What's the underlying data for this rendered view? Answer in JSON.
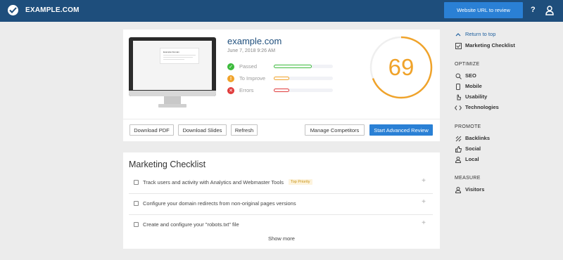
{
  "header": {
    "brand": "EXAMPLE.COM",
    "url_button": "Website URL to review",
    "help": "?"
  },
  "summary": {
    "thumbnail_title": "Example Domain",
    "site": "example.com",
    "date": "June 7, 2018 9:26 AM",
    "score": "69",
    "score_fraction": 0.69,
    "status": [
      {
        "label": "Passed",
        "color": "#3cba3c",
        "symbol": "✓",
        "level": 0.64
      },
      {
        "label": "To Improve",
        "color": "#f0a32a",
        "symbol": "!",
        "level": 0.26
      },
      {
        "label": "Errors",
        "color": "#e03b3b",
        "symbol": "✕",
        "level": 0.26
      }
    ],
    "buttons": {
      "download_pdf": "Download PDF",
      "download_slides": "Download Slides",
      "refresh": "Refresh",
      "manage_competitors": "Manage Competitors",
      "start_review": "Start Advanced Review"
    }
  },
  "checklist": {
    "title": "Marketing Checklist",
    "items": [
      {
        "text": "Track users and activity with Analytics and Webmaster Tools",
        "badge": "Top Priority"
      },
      {
        "text": "Configure your domain redirects from non-original pages versions"
      },
      {
        "text": "Create and configure your \"robots.txt\" file"
      }
    ],
    "show_more": "Show more"
  },
  "sidebar": {
    "return_top": "Return to top",
    "marketing_checklist": "Marketing Checklist",
    "optimize_heading": "OPTIMIZE",
    "optimize": [
      "SEO",
      "Mobile",
      "Usability",
      "Technologies"
    ],
    "promote_heading": "PROMOTE",
    "promote": [
      "Backlinks",
      "Social",
      "Local"
    ],
    "measure_heading": "MEASURE",
    "measure": [
      "Visitors"
    ]
  },
  "colors": {
    "topbar": "#1e4e7c",
    "accent_blue": "#2a80d5",
    "score_orange": "#f0a32a",
    "passed_green": "#3cba3c",
    "error_red": "#e03b3b"
  }
}
